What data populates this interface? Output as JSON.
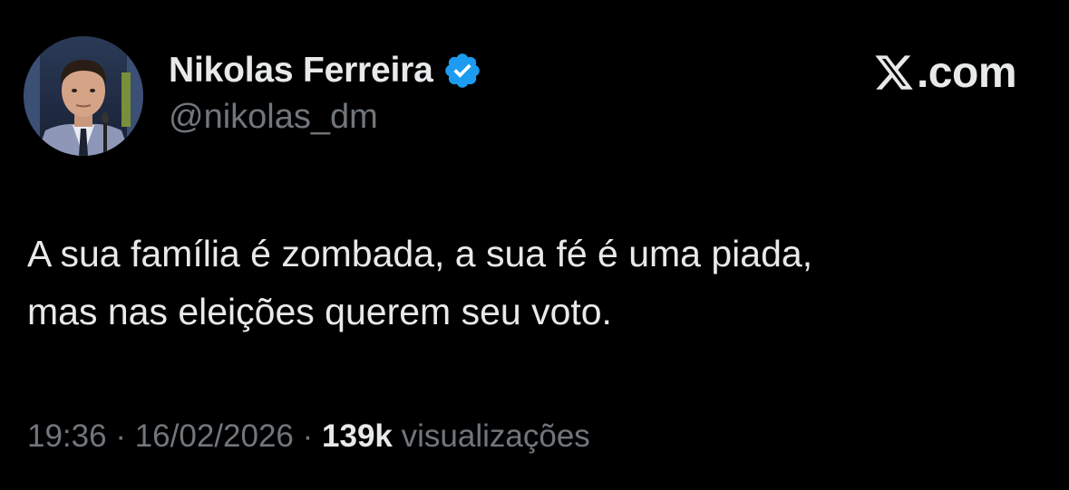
{
  "author": {
    "display_name": "Nikolas Ferreira",
    "handle": "@nikolas_dm",
    "verified": true,
    "verified_icon": "verified-badge-icon",
    "verified_color": "#1d9bf0",
    "avatar": "profile-photo"
  },
  "brand": {
    "icon": "x-logo-icon",
    "text": ".com"
  },
  "tweet": {
    "lines": [
      "A sua família é zombada, a sua fé é uma piada,",
      "mas nas eleições querem seu voto."
    ]
  },
  "meta": {
    "time": "19:36",
    "separator": "·",
    "date": "16/02/2026",
    "views_count": "139k",
    "views_label": "visualizações"
  },
  "colors": {
    "background": "#000000",
    "primary_text": "#e7e9ea",
    "secondary_text": "#71767b"
  }
}
